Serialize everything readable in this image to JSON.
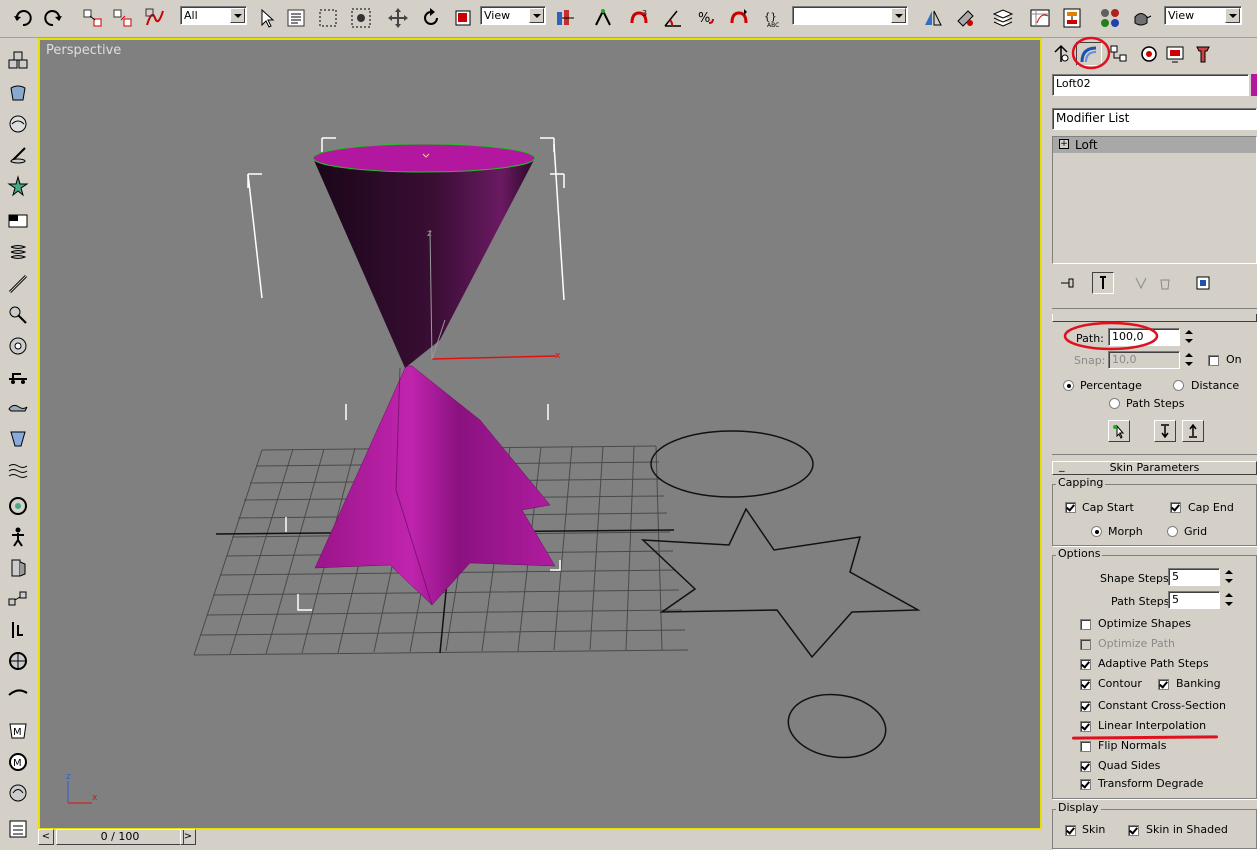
{
  "toolbar": {
    "selection_filter": "All",
    "ref_coord_system": "View",
    "named_selection": "",
    "view_dropdown": "View",
    "icons": [
      "undo-icon",
      "redo-icon",
      "select-link-icon",
      "unlink-icon",
      "bind-spacewarp-icon",
      "select-icon",
      "select-by-name-icon",
      "rect-region-icon",
      "window-crossing-icon",
      "move-icon",
      "rotate-icon",
      "scale-icon",
      "pivot-icon",
      "manipulate-icon",
      "snap-3d-icon",
      "angle-snap-icon",
      "percent-snap-icon",
      "spinner-snap-icon",
      "named-selection-icon",
      "mirror-icon",
      "align-icon",
      "layer-manager-icon",
      "curve-editor-icon",
      "schematic-view-icon",
      "material-editor-icon",
      "render-scene-icon"
    ]
  },
  "viewport": {
    "label": "Perspective",
    "axes": {
      "x": "x",
      "y": "y",
      "z": "z"
    },
    "object_color": "#b3179f"
  },
  "timeslider": {
    "value": "0 / 100",
    "prev": "<",
    "next": ">"
  },
  "command_panel": {
    "tabs": [
      "create-tab",
      "modify-tab",
      "hierarchy-tab",
      "motion-tab",
      "display-tab",
      "utilities-tab"
    ],
    "object_name": "Loft02",
    "object_color": "#b3179f",
    "modifier_list": "Modifier List",
    "stack": [
      {
        "expand": "+",
        "label": "Loft"
      }
    ],
    "path_params": {
      "path_label": "Path:",
      "path_value": "100,0",
      "snap_label": "Snap:",
      "snap_value": "10,0",
      "on_label": "On",
      "percentage": "Percentage",
      "distance": "Distance",
      "path_steps": "Path Steps"
    },
    "skin_params": {
      "title": "Skin Parameters",
      "collapse": "_",
      "capping_title": "Capping",
      "cap_start": "Cap Start",
      "cap_end": "Cap End",
      "morph": "Morph",
      "grid": "Grid",
      "options_title": "Options",
      "shape_steps_label": "Shape Steps:",
      "shape_steps_value": "5",
      "path_steps_label": "Path Steps:",
      "path_steps_value": "5",
      "optimize_shapes": "Optimize Shapes",
      "optimize_path": "Optimize Path",
      "adaptive_path_steps": "Adaptive Path Steps",
      "contour": "Contour",
      "banking": "Banking",
      "constant_cross_section": "Constant Cross-Section",
      "linear_interpolation": "Linear Interpolation",
      "flip_normals": "Flip Normals",
      "quad_sides": "Quad Sides",
      "transform_degrade": "Transform Degrade",
      "display_title": "Display",
      "skin": "Skin",
      "skin_in_shaded": "Skin in Shaded"
    },
    "annotation_color": "#e0101e"
  }
}
